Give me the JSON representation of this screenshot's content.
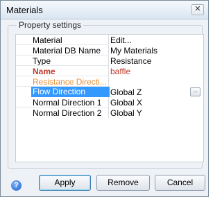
{
  "window": {
    "title": "Materials",
    "close_glyph": "✕"
  },
  "group": {
    "label": "Property settings"
  },
  "properties": [
    {
      "name": "Material",
      "value": "Edit...",
      "style": ""
    },
    {
      "name": "Material DB Name",
      "value": "My Materials",
      "style": ""
    },
    {
      "name": "Type",
      "value": "Resistance",
      "style": ""
    },
    {
      "name": "Name",
      "value": "baffle",
      "style": "bold-red"
    },
    {
      "name": "Resistance Directi...",
      "value": "",
      "style": "orange"
    },
    {
      "name": "Flow Direction",
      "value": "Global Z",
      "style": "selected"
    },
    {
      "name": "Normal Direction 1",
      "value": "Global X",
      "style": ""
    },
    {
      "name": "Normal Direction 2",
      "value": "Global Y",
      "style": ""
    }
  ],
  "ellipsis_label": "...",
  "help_glyph": "?",
  "buttons": {
    "apply": "Apply",
    "remove": "Remove",
    "cancel": "Cancel"
  },
  "colors": {
    "selection": "#3399ff",
    "required_red": "#c0392b",
    "warning_orange": "#e8913a"
  },
  "icons": {
    "help": "help-icon",
    "close": "close-icon"
  }
}
